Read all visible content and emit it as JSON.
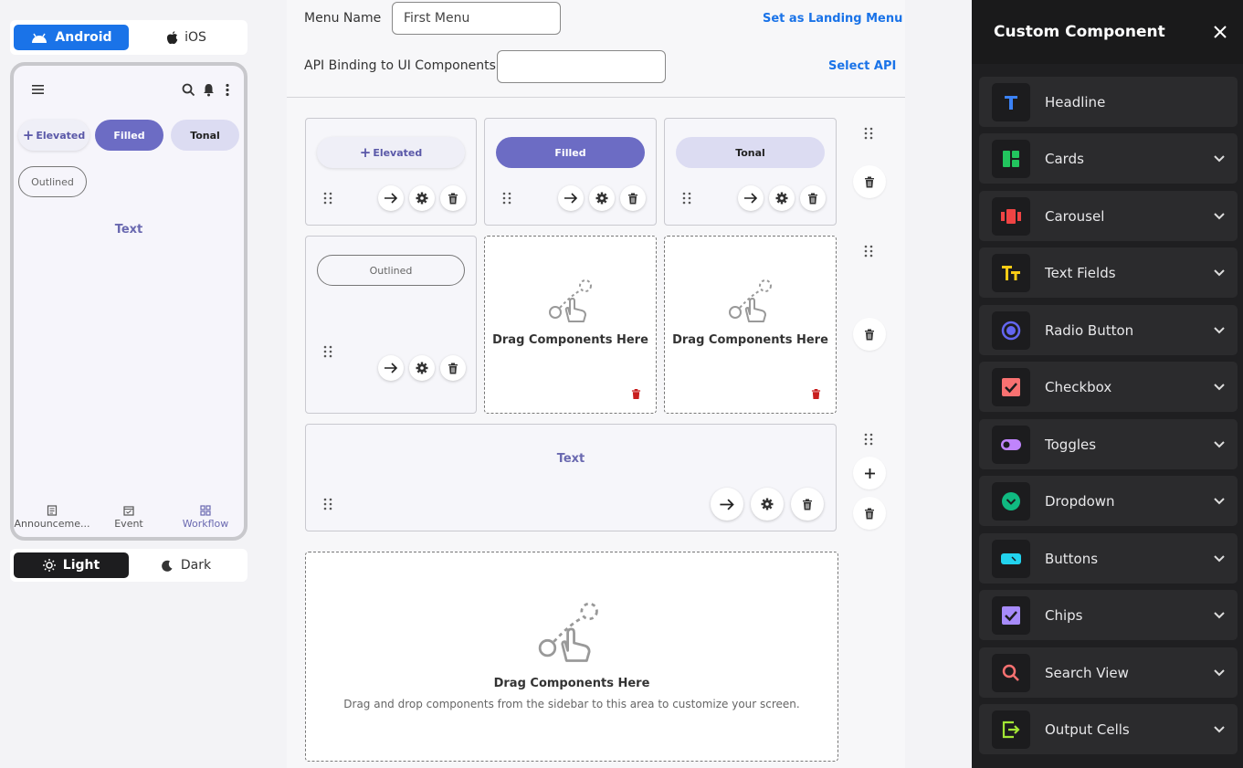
{
  "platform": {
    "android_label": "Android",
    "ios_label": "iOS"
  },
  "preview": {
    "chips": {
      "elevated": "Elevated",
      "filled": "Filled",
      "tonal": "Tonal",
      "outlined": "Outlined"
    },
    "text": "Text",
    "nav": [
      "Announceme...",
      "Event",
      "Workflow"
    ]
  },
  "theme": {
    "light_label": "Light",
    "dark_label": "Dark"
  },
  "editor": {
    "menu_name_label": "Menu Name",
    "menu_name_value": "First Menu",
    "landing_link": "Set as Landing Menu",
    "api_label": "API Binding to UI Components",
    "api_value": "",
    "select_api_link": "Select API",
    "cells": {
      "elevated": "Elevated",
      "filled": "Filled",
      "tonal": "Tonal",
      "outlined": "Outlined",
      "text": "Text"
    },
    "drag_title": "Drag Components Here",
    "drag_hint": "Drag and drop components from the sidebar to this area to customize your screen."
  },
  "panel": {
    "title": "Custom Component",
    "items": [
      {
        "label": "Headline",
        "icon": "headline-icon",
        "color": "#3b82f6"
      },
      {
        "label": "Cards",
        "icon": "cards-icon",
        "color": "#22c55e"
      },
      {
        "label": "Carousel",
        "icon": "carousel-icon",
        "color": "#ef4444"
      },
      {
        "label": "Text Fields",
        "icon": "text-fields-icon",
        "color": "#facc15"
      },
      {
        "label": "Radio Button",
        "icon": "radio-button-icon",
        "color": "#6366f1"
      },
      {
        "label": "Checkbox",
        "icon": "checkbox-icon",
        "color": "#f87171"
      },
      {
        "label": "Toggles",
        "icon": "toggle-icon",
        "color": "#c084fc"
      },
      {
        "label": "Dropdown",
        "icon": "dropdown-icon",
        "color": "#10b981"
      },
      {
        "label": "Buttons",
        "icon": "buttons-icon",
        "color": "#22d3ee"
      },
      {
        "label": "Chips",
        "icon": "chips-icon",
        "color": "#a78bfa"
      },
      {
        "label": "Search View",
        "icon": "search-icon",
        "color": "#f87171"
      },
      {
        "label": "Output Cells",
        "icon": "output-cells-icon",
        "color": "#a3e635"
      }
    ]
  }
}
